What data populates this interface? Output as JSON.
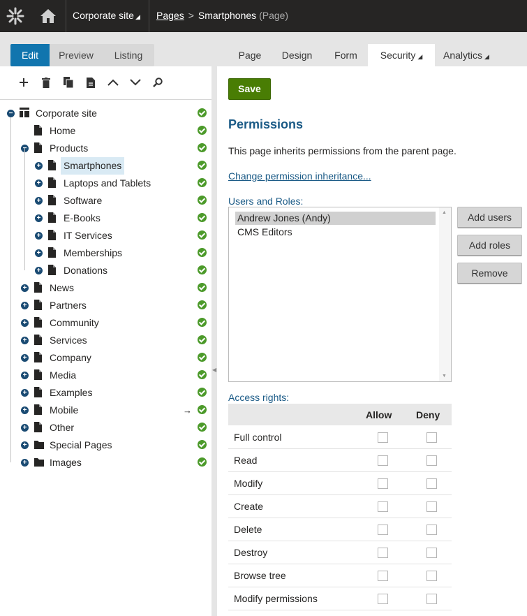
{
  "topbar": {
    "site_label": "Corporate site",
    "breadcrumb_link": "Pages",
    "breadcrumb_separator": ">",
    "breadcrumb_current": "Smartphones",
    "breadcrumb_type": "(Page)"
  },
  "modes": [
    "Edit",
    "Preview",
    "Listing"
  ],
  "toolbar_icons": [
    "plus-icon",
    "trash-icon",
    "copy-icon",
    "document-icon",
    "chevron-up-icon",
    "chevron-down-icon",
    "search-icon"
  ],
  "tree": [
    {
      "label": "Corporate site",
      "level": 0,
      "toggle": "−",
      "icon": "site"
    },
    {
      "label": "Home",
      "level": 1,
      "toggle": "",
      "icon": "page"
    },
    {
      "label": "Products",
      "level": 1,
      "toggle": "−",
      "icon": "page"
    },
    {
      "label": "Smartphones",
      "level": 2,
      "toggle": "+",
      "icon": "page",
      "selected": true
    },
    {
      "label": "Laptops and Tablets",
      "level": 2,
      "toggle": "+",
      "icon": "page"
    },
    {
      "label": "Software",
      "level": 2,
      "toggle": "+",
      "icon": "page"
    },
    {
      "label": "E-Books",
      "level": 2,
      "toggle": "+",
      "icon": "page"
    },
    {
      "label": "IT Services",
      "level": 2,
      "toggle": "+",
      "icon": "page"
    },
    {
      "label": "Memberships",
      "level": 2,
      "toggle": "+",
      "icon": "page"
    },
    {
      "label": "Donations",
      "level": 2,
      "toggle": "+",
      "icon": "page"
    },
    {
      "label": "News",
      "level": 1,
      "toggle": "+",
      "icon": "page"
    },
    {
      "label": "Partners",
      "level": 1,
      "toggle": "+",
      "icon": "page"
    },
    {
      "label": "Community",
      "level": 1,
      "toggle": "+",
      "icon": "page"
    },
    {
      "label": "Services",
      "level": 1,
      "toggle": "+",
      "icon": "page"
    },
    {
      "label": "Company",
      "level": 1,
      "toggle": "+",
      "icon": "page"
    },
    {
      "label": "Media",
      "level": 1,
      "toggle": "+",
      "icon": "page"
    },
    {
      "label": "Examples",
      "level": 1,
      "toggle": "+",
      "icon": "page"
    },
    {
      "label": "Mobile",
      "level": 1,
      "toggle": "+",
      "icon": "page",
      "arrow": "→"
    },
    {
      "label": "Other",
      "level": 1,
      "toggle": "+",
      "icon": "page"
    },
    {
      "label": "Special Pages",
      "level": 1,
      "toggle": "+",
      "icon": "folder"
    },
    {
      "label": "Images",
      "level": 1,
      "toggle": "+",
      "icon": "folder"
    }
  ],
  "tabs": [
    {
      "label": "Page",
      "caret": false
    },
    {
      "label": "Design",
      "caret": false
    },
    {
      "label": "Form",
      "caret": false
    },
    {
      "label": "Security",
      "caret": true,
      "active": true
    },
    {
      "label": "Analytics",
      "caret": true
    }
  ],
  "main": {
    "save_label": "Save",
    "permissions_heading": "Permissions",
    "inherit_text": "This page inherits permissions from the parent page.",
    "inherit_link": "Change permission inheritance...",
    "users_roles_label": "Users and Roles:",
    "users_roles": [
      "Andrew Jones (Andy)",
      "CMS Editors"
    ],
    "add_users_label": "Add users",
    "add_roles_label": "Add roles",
    "remove_label": "Remove",
    "access_rights_label": "Access rights:",
    "allow_header": "Allow",
    "deny_header": "Deny",
    "rights": [
      "Full control",
      "Read",
      "Modify",
      "Create",
      "Delete",
      "Destroy",
      "Browse tree",
      "Modify permissions"
    ]
  },
  "colors": {
    "topbar": "#262524",
    "accent_blue": "#1175ae",
    "heading_blue": "#1a5a86",
    "save_green": "#497d04",
    "check_green": "#4c9a2a"
  }
}
